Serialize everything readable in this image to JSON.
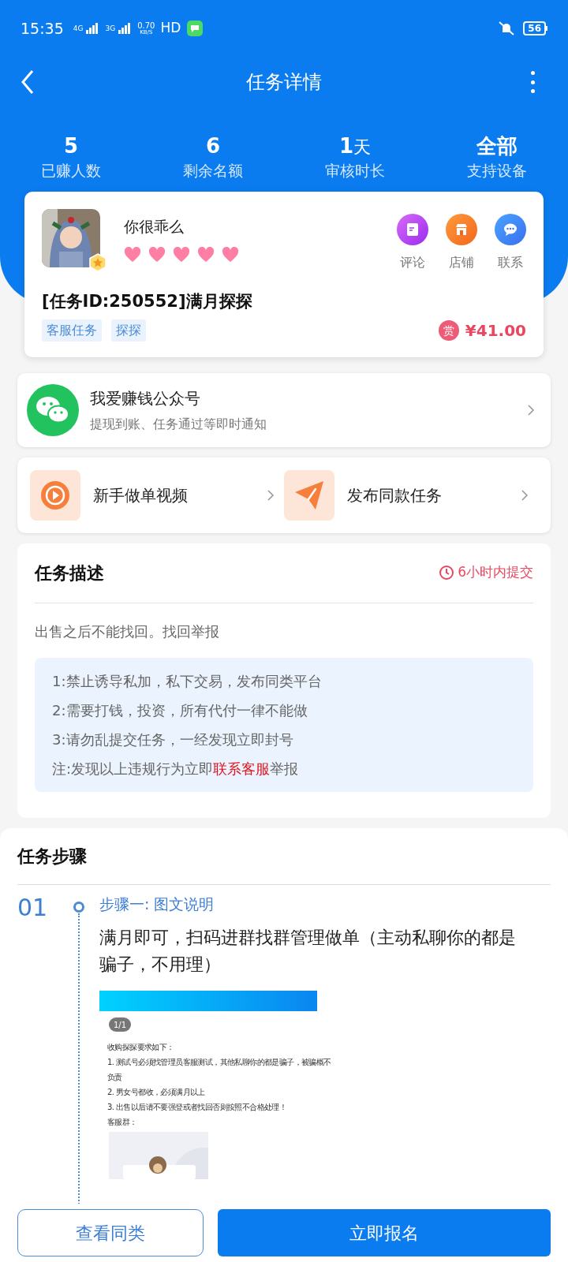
{
  "status_bar": {
    "time": "15:35",
    "net_1": "4G",
    "net_2": "3G",
    "speed_value": "0.70",
    "speed_unit": "KB/S",
    "hd": "HD",
    "battery": "56"
  },
  "nav": {
    "title": "任务详情"
  },
  "stats": [
    {
      "value": "5",
      "label": "已赚人数"
    },
    {
      "value": "6",
      "label": "剩余名额"
    },
    {
      "value": "1",
      "unit": "天",
      "label": "审核时长"
    },
    {
      "value": "全部",
      "label": "支持设备"
    }
  ],
  "publisher": {
    "name": "你很乖么",
    "stars": 5,
    "actions": [
      {
        "kind": "comment",
        "label": "评论"
      },
      {
        "kind": "shop",
        "label": "店铺"
      },
      {
        "kind": "contact",
        "label": "联系"
      }
    ]
  },
  "task": {
    "title": "[任务ID:250552]满月探探",
    "tags": [
      "客服任务",
      "探探"
    ],
    "reward_mark": "赏",
    "reward": "¥41.00"
  },
  "wechat": {
    "title": "我爱赚钱公众号",
    "subtitle": "提现到账、任务通过等即时通知"
  },
  "shortcuts": [
    {
      "kind": "video",
      "label": "新手做单视频"
    },
    {
      "kind": "publish",
      "label": "发布同款任务"
    }
  ],
  "description": {
    "title": "任务描述",
    "deadline": "6小时内提交",
    "text": "出售之后不能找回。找回举报",
    "rules": [
      "1:禁止诱导私加，私下交易，发布同类平台",
      "2:需要打钱，投资，所有代付一律不能做",
      "3:请勿乱提交任务，一经发现立即封号"
    ],
    "note": {
      "before": "注:发现以上违规行为立即",
      "link": "联系客服",
      "after": "举报"
    }
  },
  "steps": {
    "title": "任务步骤",
    "items": [
      {
        "number": "01",
        "title": "步骤一: 图文说明",
        "text": "满月即可，扫码进群找群管理做单（主动私聊你的都是骗子，不用理）",
        "image": {
          "page_badge": "1/1",
          "lines": [
            "收购探探要求如下：",
            "1.  测试号必须找管理员客服测试，其他私聊你的都是骗子，被骗概不",
            "负责",
            "2.  男女号都收，必须满月以上",
            "3.  出售以后请不要强登或者找回否则按照不合格处理！",
            "客服群："
          ]
        }
      }
    ]
  },
  "buttons": [
    {
      "kind": "secondary",
      "label": "查看同类"
    },
    {
      "kind": "primary",
      "label": "立即报名"
    }
  ]
}
